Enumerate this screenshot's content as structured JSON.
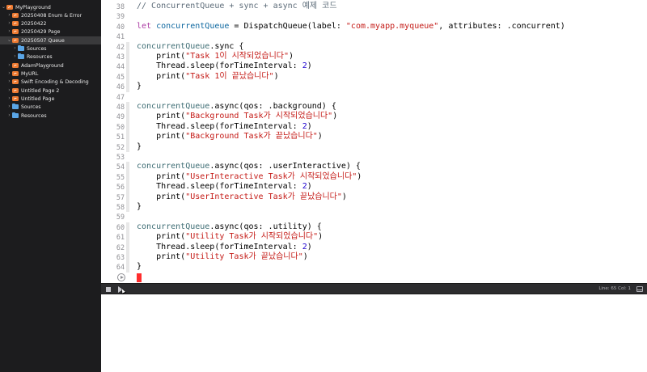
{
  "sidebar": {
    "items": [
      {
        "label": "MyPlayground",
        "icon": "swift-icon",
        "chevron": "v",
        "selected": false
      },
      {
        "label": "20250408 Enum & Error",
        "icon": "swift-icon",
        "chevron": ">",
        "selected": false
      },
      {
        "label": "20250422",
        "icon": "swift-icon",
        "chevron": ">",
        "selected": false
      },
      {
        "label": "20250429 Page",
        "icon": "swift-icon",
        "chevron": ">",
        "selected": false
      },
      {
        "label": "20250507 Queue",
        "icon": "swift-icon",
        "chevron": "v",
        "selected": true
      },
      {
        "label": "Sources",
        "icon": "folder-icon",
        "chevron": ">",
        "selected": false
      },
      {
        "label": "Resources",
        "icon": "folder-icon",
        "chevron": ">",
        "selected": false
      },
      {
        "label": "AdamPlayground",
        "icon": "swift-icon",
        "chevron": ">",
        "selected": false
      },
      {
        "label": "MyURL",
        "icon": "swift-icon",
        "chevron": ">",
        "selected": false
      },
      {
        "label": "Swift Encoding & Decoding",
        "icon": "swift-icon",
        "chevron": ">",
        "selected": false
      },
      {
        "label": "Untitled Page 2",
        "icon": "swift-icon",
        "chevron": ">",
        "selected": false
      },
      {
        "label": "Untitled Page",
        "icon": "swift-icon",
        "chevron": ">",
        "selected": false
      },
      {
        "label": "Sources",
        "icon": "folder-icon",
        "chevron": ">",
        "selected": false
      },
      {
        "label": "Resources",
        "icon": "folder-icon",
        "chevron": ">",
        "selected": false
      }
    ]
  },
  "editor": {
    "lines": [
      {
        "n": "38",
        "t": [
          {
            "c": "cm",
            "s": "// ConcurrentQueue + sync + async 예제 코드"
          }
        ]
      },
      {
        "n": "39",
        "t": []
      },
      {
        "n": "40",
        "t": [
          {
            "c": "kw",
            "s": "let"
          },
          {
            "c": "",
            "s": " "
          },
          {
            "c": "var",
            "s": "concurrentQueue"
          },
          {
            "c": "",
            "s": " = DispatchQueue(label: "
          },
          {
            "c": "str",
            "s": "\"com.myapp.myqueue\""
          },
          {
            "c": "",
            "s": ", attributes: .concurrent)"
          }
        ]
      },
      {
        "n": "41",
        "t": []
      },
      {
        "n": "42",
        "t": [
          {
            "c": "fn",
            "s": "concurrentQueue"
          },
          {
            "c": "",
            "s": ".sync {"
          }
        ]
      },
      {
        "n": "43",
        "t": [
          {
            "c": "",
            "s": "    print("
          },
          {
            "c": "str",
            "s": "\"Task 1이 시작되었습니다\""
          },
          {
            "c": "",
            "s": ")"
          }
        ]
      },
      {
        "n": "44",
        "t": [
          {
            "c": "",
            "s": "    Thread.sleep(forTimeInterval: "
          },
          {
            "c": "num",
            "s": "2"
          },
          {
            "c": "",
            "s": ")"
          }
        ]
      },
      {
        "n": "45",
        "t": [
          {
            "c": "",
            "s": "    print("
          },
          {
            "c": "str",
            "s": "\"Task 1이 끝났습니다\""
          },
          {
            "c": "",
            "s": ")"
          }
        ]
      },
      {
        "n": "46",
        "t": [
          {
            "c": "",
            "s": "}"
          }
        ]
      },
      {
        "n": "47",
        "t": []
      },
      {
        "n": "48",
        "t": [
          {
            "c": "fn",
            "s": "concurrentQueue"
          },
          {
            "c": "",
            "s": ".async(qos: .background) {"
          }
        ]
      },
      {
        "n": "49",
        "t": [
          {
            "c": "",
            "s": "    print("
          },
          {
            "c": "str",
            "s": "\"Background Task가 시작되었습니다\""
          },
          {
            "c": "",
            "s": ")"
          }
        ]
      },
      {
        "n": "50",
        "t": [
          {
            "c": "",
            "s": "    Thread.sleep(forTimeInterval: "
          },
          {
            "c": "num",
            "s": "2"
          },
          {
            "c": "",
            "s": ")"
          }
        ]
      },
      {
        "n": "51",
        "t": [
          {
            "c": "",
            "s": "    print("
          },
          {
            "c": "str",
            "s": "\"Background Task가 끝났습니다\""
          },
          {
            "c": "",
            "s": ")"
          }
        ]
      },
      {
        "n": "52",
        "t": [
          {
            "c": "",
            "s": "}"
          }
        ]
      },
      {
        "n": "53",
        "t": []
      },
      {
        "n": "54",
        "t": [
          {
            "c": "fn",
            "s": "concurrentQueue"
          },
          {
            "c": "",
            "s": ".async(qos: .userInteractive) {"
          }
        ]
      },
      {
        "n": "55",
        "t": [
          {
            "c": "",
            "s": "    print("
          },
          {
            "c": "str",
            "s": "\"UserInteractive Task가 시작되었습니다\""
          },
          {
            "c": "",
            "s": ")"
          }
        ]
      },
      {
        "n": "56",
        "t": [
          {
            "c": "",
            "s": "    Thread.sleep(forTimeInterval: "
          },
          {
            "c": "num",
            "s": "2"
          },
          {
            "c": "",
            "s": ")"
          }
        ]
      },
      {
        "n": "57",
        "t": [
          {
            "c": "",
            "s": "    print("
          },
          {
            "c": "str",
            "s": "\"UserInteractive Task가 끝났습니다\""
          },
          {
            "c": "",
            "s": ")"
          }
        ]
      },
      {
        "n": "58",
        "t": [
          {
            "c": "",
            "s": "}"
          }
        ]
      },
      {
        "n": "59",
        "t": []
      },
      {
        "n": "60",
        "t": [
          {
            "c": "fn",
            "s": "concurrentQueue"
          },
          {
            "c": "",
            "s": ".async(qos: .utility) {"
          }
        ]
      },
      {
        "n": "61",
        "t": [
          {
            "c": "",
            "s": "    print("
          },
          {
            "c": "str",
            "s": "\"Utility Task가 시작되었습니다\""
          },
          {
            "c": "",
            "s": ")"
          }
        ]
      },
      {
        "n": "62",
        "t": [
          {
            "c": "",
            "s": "    Thread.sleep(forTimeInterval: "
          },
          {
            "c": "num",
            "s": "2"
          },
          {
            "c": "",
            "s": ")"
          }
        ]
      },
      {
        "n": "63",
        "t": [
          {
            "c": "",
            "s": "    print("
          },
          {
            "c": "str",
            "s": "\"Utility Task가 끝났습니다\""
          },
          {
            "c": "",
            "s": ")"
          }
        ]
      },
      {
        "n": "64",
        "t": [
          {
            "c": "",
            "s": "}"
          }
        ]
      }
    ]
  },
  "debugbar": {
    "status": "Line: 65  Col: 1"
  },
  "colors": {
    "sidebar_bg": "#1c1c1e",
    "keyword": "#ad3da4",
    "string": "#c41a16",
    "number": "#1c00cf",
    "comment": "#5d6c79",
    "cursor_marker": "#ff2d2d"
  }
}
